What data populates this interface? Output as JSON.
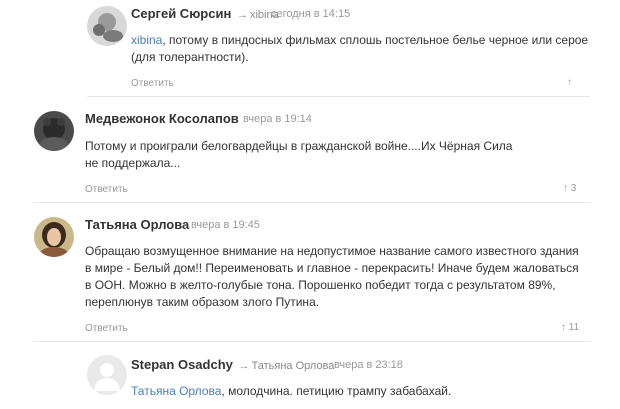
{
  "comments": [
    {
      "author": "Сергей Сюрсин",
      "reply_to": "xibina",
      "time": "сегодня в 14:15",
      "mention": "xibina",
      "text": ", потому в пиндосных фильмах сплошь постельное белье черное или серое (для толерантности).",
      "answer_label": "Ответить",
      "votes": ""
    },
    {
      "author": "Медвежонок Косолапов",
      "reply_to": "",
      "time": "вчера в 19:14",
      "mention": "",
      "text": "Потому и проиграли белогвардейцы в гражданской войне....Их Чёрная Сила не поддержала...",
      "answer_label": "Ответить",
      "votes": "3"
    },
    {
      "author": "Татьяна Орлова",
      "reply_to": "",
      "time": "вчера в 19:45",
      "mention": "",
      "text": "Обращаю возмущенное внимание на недопустимое название самого известного здания в мире - Белый дом!! Переименовать и главное - перекрасить! Иначе будем жаловаться в ООН. Можно в желто-голубые тона. Порошенко победит тогда с результатом 89%, переплюнув таким образом злого Путина.",
      "answer_label": "Ответить",
      "votes": "11"
    },
    {
      "author": "Stepan Osadchy",
      "reply_to": "Татьяна Орлова",
      "time": "вчера в 23:18",
      "mention": "Татьяна Орлова",
      "text": ", молодчина. петицию трампу забабахай.",
      "answer_label": "",
      "votes": ""
    }
  ],
  "icons": {
    "upvote": "upvote-arrow-icon",
    "reply_arrow": "reply-arrow-icon"
  },
  "colors": {
    "link": "#4a7fb5",
    "muted": "#999999",
    "text": "#333333"
  }
}
